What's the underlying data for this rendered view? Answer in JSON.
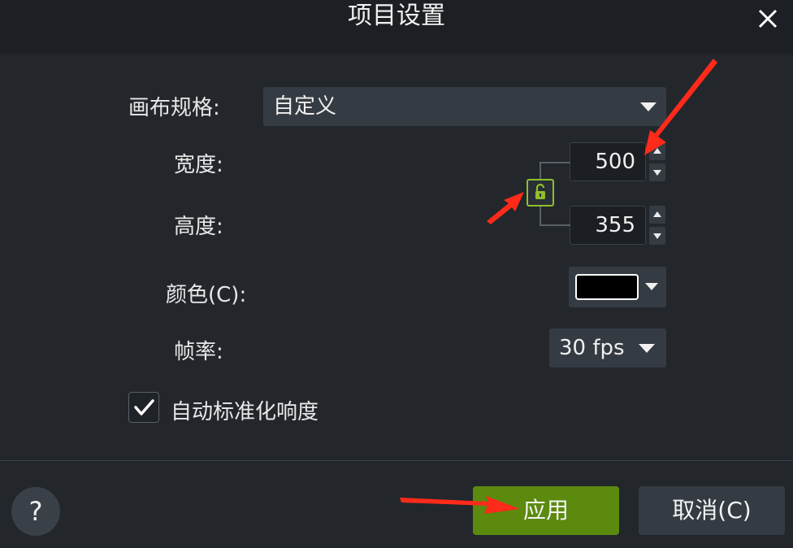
{
  "window": {
    "title": "项目设置"
  },
  "form": {
    "canvas_label": "画布规格:",
    "canvas_value": "自定义",
    "width_label": "宽度:",
    "width_value": "500",
    "height_label": "高度:",
    "height_value": "355",
    "color_label": "颜色(C):",
    "color_value": "#000000",
    "framerate_label": "帧率:",
    "framerate_value": "30 fps",
    "normalize_label": "自动标准化响度",
    "normalize_checked": true
  },
  "footer": {
    "help_label": "?",
    "apply_label": "应用",
    "cancel_label": "取消(C)"
  },
  "icons": [
    "close-icon",
    "dropdown-arrow-icon",
    "lock-open-icon",
    "spinner-up-icon",
    "spinner-down-icon",
    "checkmark-icon",
    "annotation-arrow-icon"
  ],
  "colors": {
    "accent": "#5b8a0f",
    "lock": "#8fbf2a",
    "annotation": "#ff2a1a"
  }
}
